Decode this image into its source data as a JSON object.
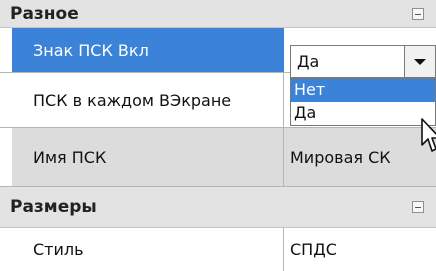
{
  "sections": [
    {
      "title": "Разное"
    },
    {
      "title": "Размеры"
    }
  ],
  "rows": [
    {
      "name": "Знак ПСК Вкл",
      "value": "Да"
    },
    {
      "name": "ПСК в каждом ВЭкране",
      "value": ""
    },
    {
      "name": "Имя ПСК",
      "value": "Мировая СК"
    },
    {
      "name": "Стиль",
      "value": "СПДС"
    }
  ],
  "dropdown": {
    "selected": "Да",
    "options": [
      "Нет",
      "Да"
    ],
    "highlighted": "Нет"
  },
  "colors": {
    "selection": "#3b83d8",
    "section_bg": "#e3e3e3",
    "gray_row": "#dcdcdc"
  },
  "icons": [
    "collapse-icon",
    "dropdown-arrow-icon",
    "mouse-cursor-icon"
  ]
}
